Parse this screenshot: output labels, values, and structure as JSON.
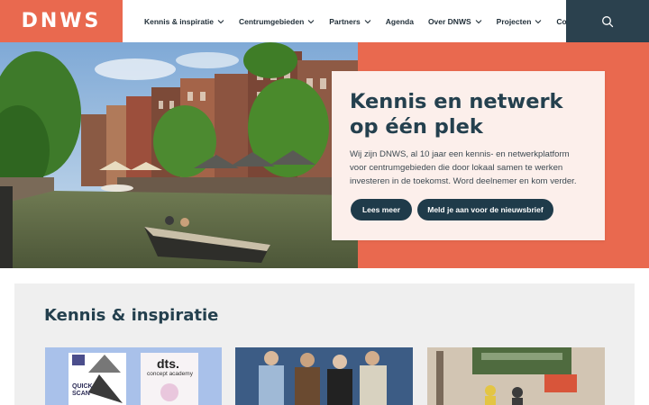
{
  "header": {
    "logo": "DNWS",
    "nav": [
      {
        "label": "Kennis & inspiratie",
        "dropdown": true
      },
      {
        "label": "Centrumgebieden",
        "dropdown": true
      },
      {
        "label": "Partners",
        "dropdown": true
      },
      {
        "label": "Agenda",
        "dropdown": false
      },
      {
        "label": "Over DNWS",
        "dropdown": true
      },
      {
        "label": "Projecten",
        "dropdown": true
      },
      {
        "label": "Contact",
        "dropdown": false
      }
    ],
    "search_icon": "search-icon"
  },
  "hero": {
    "title": "Kennis en netwerk op één plek",
    "text": "Wij zijn DNWS, al 10 jaar een kennis- en netwerkplatform voor centrumgebieden die door lokaal samen te werken investeren in de toekomst. Word deelnemer en kom verder.",
    "buttons": {
      "primary": "Lees meer",
      "secondary": "Meld je aan voor de nieuwsbrief"
    }
  },
  "section": {
    "title": "Kennis & inspiratie",
    "card1": {
      "badge": "QUICK SCAN",
      "logo_text": "dts.",
      "logo_sub": "concept academy"
    }
  },
  "colors": {
    "brand_orange": "#e9694f",
    "navy": "#24404e",
    "search_bg": "#2b414e",
    "card_bg": "#fcefeb",
    "section_bg": "#efefef"
  }
}
